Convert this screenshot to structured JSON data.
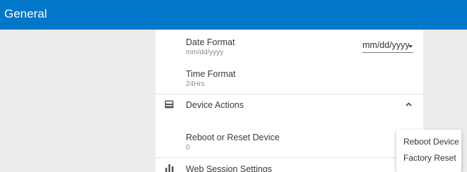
{
  "header": {
    "title": "General"
  },
  "date_format": {
    "label": "Date Format",
    "value": "mm/dd/yyyy",
    "selected_option": "mm/dd/yyyy"
  },
  "time_format": {
    "label": "Time Format",
    "value": "24Hrs"
  },
  "device_actions": {
    "label": "Device Actions",
    "icon": "device-icon",
    "expand_icon": "chevron-up-icon"
  },
  "reboot_reset": {
    "label": "Reboot or Reset Device",
    "value": "0"
  },
  "web_session": {
    "label": "Web Session Settings",
    "icon": "bar-chart-icon"
  },
  "action_menu": {
    "items": [
      "Reboot Device",
      "Factory Reset"
    ]
  },
  "colors": {
    "header_bg": "#0077c8",
    "page_bg": "#ececec",
    "panel_bg": "#ffffff"
  }
}
